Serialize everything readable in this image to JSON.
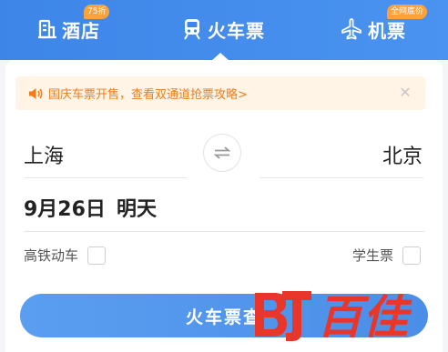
{
  "tabs": {
    "hotel": {
      "label": "酒店",
      "badge": "75折",
      "icon": "hotel-icon"
    },
    "train": {
      "label": "火车票",
      "icon": "train-icon",
      "active": true
    },
    "flight": {
      "label": "机票",
      "badge": "全网底价",
      "icon": "plane-icon"
    }
  },
  "notice": {
    "text": "国庆车票开售，查看双通道抢票攻略>",
    "icon": "speaker-icon",
    "close_icon": "close-icon"
  },
  "route": {
    "from": "上海",
    "to": "北京",
    "swap_icon": "swap-icon"
  },
  "date": {
    "date": "9月26日",
    "day": "明天"
  },
  "options": {
    "high_speed": {
      "label": "高铁动车",
      "checked": false
    },
    "student": {
      "label": "学生票",
      "checked": false
    }
  },
  "search_button": {
    "label": "火车票查"
  },
  "watermark": {
    "text": "百佳"
  },
  "colors": {
    "header_blue": "#3d86e8",
    "badge_orange": "#ffa13b",
    "notice_bg": "#fff4e6",
    "notice_text": "#f07d1a",
    "button_blue": "#5a9ef0",
    "watermark_red": "#e8362a"
  }
}
